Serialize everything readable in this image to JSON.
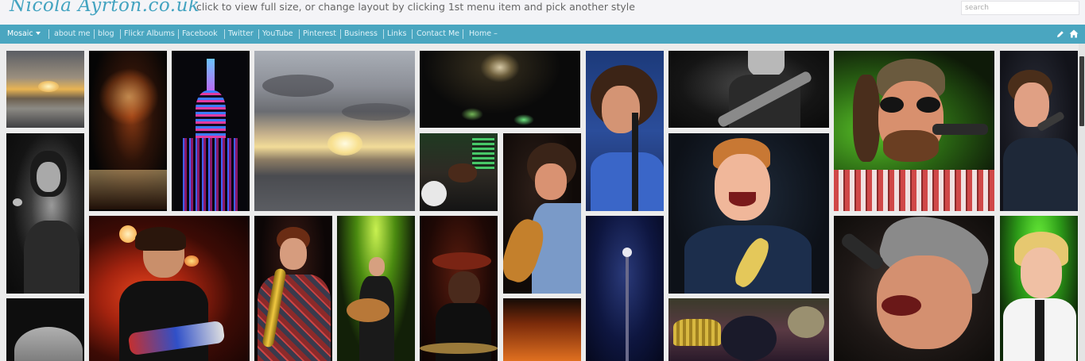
{
  "header": {
    "logo_text": "Nicola Ayrton.co.uk",
    "tagline": "click to view full size, or change layout by clicking 1st menu item and pick another style",
    "search_placeholder": "search"
  },
  "nav": {
    "mosaic_label": "Mosaic",
    "items": [
      "about me",
      "blog",
      "Flickr Albums",
      "Facebook",
      "Twitter",
      "YouTube",
      "Pinterest",
      "Business",
      "Links",
      "Contact Me"
    ],
    "home_label": "Home –",
    "edit_icon": "pencil-icon",
    "home_icon": "home-icon"
  },
  "colors": {
    "accent": "#4aa6c0",
    "header_bg": "#f4f4f7",
    "page_bg": "#ececec"
  },
  "gallery": {
    "tiles": [
      "sunset-beach-photo",
      "fireworks-photo",
      "illuminated-tower-photo",
      "sunset-clouds-photo",
      "fireworks-wide-photo",
      "singer-with-microphone-photo",
      "guitarist-black-white-photo",
      "smiling-singer-sunglasses-photo",
      "singer-blue-light-photo",
      "female-singer-black-white-photo",
      "drum-kit-photo",
      "guitarist-singing-photo",
      "laughing-man-ukulele-photo",
      "guitarist-red-stage-photo",
      "saxophonist-photo",
      "acoustic-guitarist-green-photo",
      "drummer-photo",
      "mic-stand-blue-photo",
      "singer-with-cap-photo",
      "boy-performer-green-photo",
      "sunset-sky-photo",
      "party-hats-photo",
      "bald-head-black-white-photo"
    ]
  }
}
